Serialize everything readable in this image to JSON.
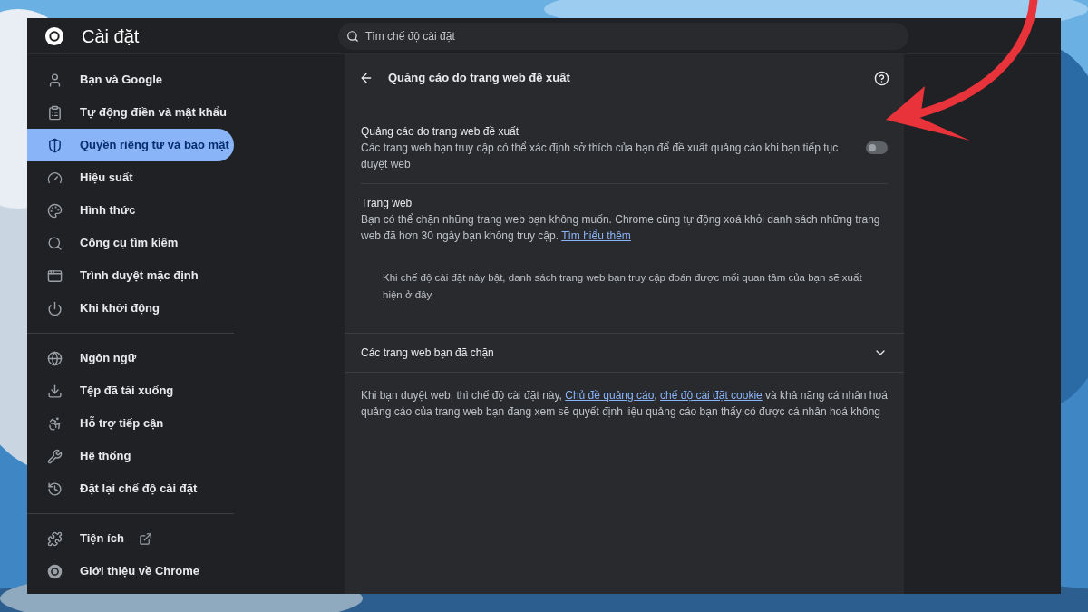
{
  "header": {
    "title": "Cài đặt",
    "search": {
      "placeholder": "Tìm chế độ cài đặt"
    }
  },
  "sidebar": {
    "groups": [
      [
        {
          "label": "Bạn và Google",
          "selected": false
        },
        {
          "label": "Tự động điền và mật khẩu",
          "selected": false
        },
        {
          "label": "Quyền riêng tư và bảo mật",
          "selected": true
        },
        {
          "label": "Hiệu suất",
          "selected": false
        },
        {
          "label": "Hình thức",
          "selected": false
        },
        {
          "label": "Công cụ tìm kiếm",
          "selected": false
        },
        {
          "label": "Trình duyệt mặc định",
          "selected": false
        },
        {
          "label": "Khi khởi động",
          "selected": false
        }
      ],
      [
        {
          "label": "Ngôn ngữ",
          "selected": false
        },
        {
          "label": "Tệp đã tải xuống",
          "selected": false
        },
        {
          "label": "Hỗ trợ tiếp cận",
          "selected": false
        },
        {
          "label": "Hệ thống",
          "selected": false
        },
        {
          "label": "Đặt lại chế độ cài đặt",
          "selected": false
        }
      ],
      [
        {
          "label": "Tiện ích",
          "selected": false,
          "external": true
        },
        {
          "label": "Giới thiệu về Chrome",
          "selected": false,
          "external": false
        }
      ]
    ]
  },
  "page": {
    "title": "Quảng cáo do trang web đề xuất",
    "setting": {
      "title": "Quảng cáo do trang web đề xuất",
      "description": "Các trang web bạn truy cập có thể xác định sở thích của bạn để đề xuất quảng cáo khi bạn tiếp tục duyệt web",
      "on": false
    },
    "sites": {
      "title": "Trang web",
      "description": [
        {
          "kind": "text",
          "text": "Bạn có thể chặn những trang web bạn không muốn. Chrome cũng tự động xoá khỏi danh sách những trang web đã hơn 30 ngày bạn không truy cập. "
        },
        {
          "kind": "link",
          "text": "Tìm hiểu thêm"
        }
      ],
      "empty_note": "Khi chế độ cài đặt này bật, danh sách trang web bạn truy cập đoán được mối quan tâm của bạn sẽ xuất hiện ở đây"
    },
    "blocked": {
      "title": "Các trang web bạn đã chặn",
      "expanded": false
    },
    "footer": [
      {
        "kind": "text",
        "text": "Khi bạn duyệt web, thì chế độ cài đặt này, "
      },
      {
        "kind": "link",
        "text": "Chủ đề quảng cáo"
      },
      {
        "kind": "text",
        "text": ", "
      },
      {
        "kind": "link",
        "text": "chế độ cài đặt cookie"
      },
      {
        "kind": "text",
        "text": " và khả năng cá nhân hoá quảng cáo của trang web bạn đang xem sẽ quyết định liệu quảng cáo bạn thấy có được cá nhân hoá không"
      }
    ]
  }
}
